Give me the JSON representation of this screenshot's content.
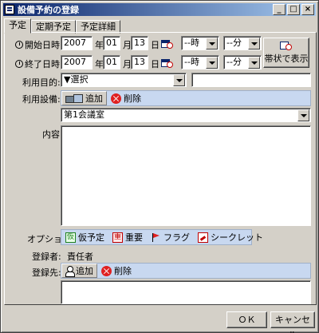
{
  "window": {
    "title": "設備予約の登録",
    "minimize": "_",
    "maximize": "□",
    "close": "×"
  },
  "tabs": [
    {
      "label": "予定",
      "active": true
    },
    {
      "label": "定期予定",
      "active": false
    },
    {
      "label": "予定詳細",
      "active": false
    }
  ],
  "start": {
    "label": "開始日時:",
    "year": "2007",
    "year_unit": "年",
    "month": "01",
    "month_unit": "月",
    "day": "13",
    "day_unit": "日",
    "hour": "--時",
    "minute": "--分"
  },
  "end": {
    "label": "終了日時:",
    "year": "2007",
    "year_unit": "年",
    "month": "01",
    "month_unit": "月",
    "day": "13",
    "day_unit": "日",
    "hour": "--時",
    "minute": "--分"
  },
  "band_button": {
    "label": "帯状で表示"
  },
  "purpose": {
    "label": "利用目的:",
    "selected": "▼選択",
    "text": ""
  },
  "equipment": {
    "label": "利用設備:",
    "add_label": "追加",
    "delete_label": "削除",
    "selected": "第1会議室"
  },
  "content": {
    "label": "内容:",
    "value": ""
  },
  "options": {
    "label": "オプション:",
    "items": [
      "仮予定",
      "重要",
      "フラグ",
      "シークレット"
    ],
    "kari_glyph": "仮",
    "juu_glyph": "重"
  },
  "registrant": {
    "label": "登録者:",
    "value": "責任者"
  },
  "destination": {
    "label": "登録先:",
    "add_label": "追加",
    "delete_label": "削除"
  },
  "footer": {
    "ok_label": "ＯＫ",
    "cancel_label": "キャンセル"
  }
}
